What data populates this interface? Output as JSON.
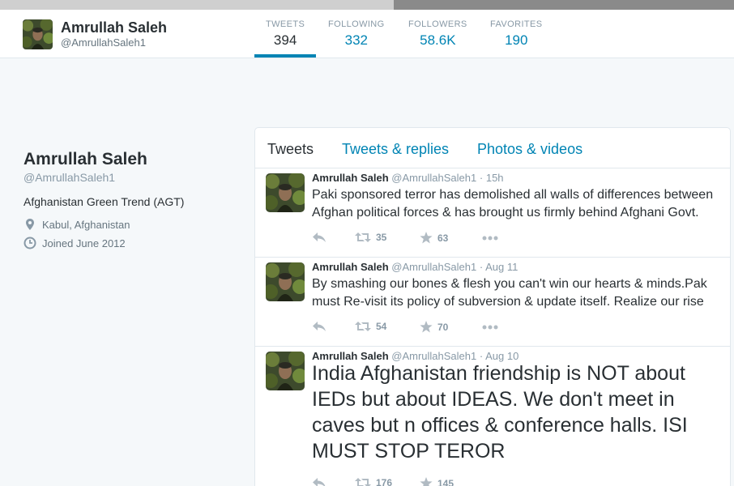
{
  "header": {
    "name": "Amrullah Saleh",
    "handle": "@AmrullahSaleh1",
    "stats": [
      {
        "label": "TWEETS",
        "value": "394"
      },
      {
        "label": "FOLLOWING",
        "value": "332"
      },
      {
        "label": "FOLLOWERS",
        "value": "58.6K"
      },
      {
        "label": "FAVORITES",
        "value": "190"
      }
    ]
  },
  "profile": {
    "name": "Amrullah Saleh",
    "handle": "@AmrullahSaleh1",
    "bio": "Afghanistan Green Trend (AGT)",
    "location": "Kabul, Afghanistan",
    "joined": "Joined June 2012"
  },
  "tabs": [
    "Tweets",
    "Tweets & replies",
    "Photos & videos"
  ],
  "tweets": [
    {
      "name": "Amrullah Saleh",
      "handle": "@AmrullahSaleh1",
      "dot": "·",
      "time": "15h",
      "text": "Paki sponsored terror has demolished all walls of differences between Afghan political forces & has brought us firmly behind Afghani Govt.",
      "retweets": "35",
      "favorites": "63"
    },
    {
      "name": "Amrullah Saleh",
      "handle": "@AmrullahSaleh1",
      "dot": "·",
      "time": "Aug 11",
      "text": "By smashing our bones & flesh you can't win our hearts & minds.Pak must Re-visit its policy of subversion & update itself. Realize our rise",
      "retweets": "54",
      "favorites": "70"
    },
    {
      "name": "Amrullah Saleh",
      "handle": "@AmrullahSaleh1",
      "dot": "·",
      "time": "Aug 10",
      "text": "India Afghanistan friendship is NOT about IEDs but about IDEAS. We don't meet in caves but n offices & conference halls. ISI MUST STOP TEROR",
      "retweets": "176",
      "favorites": "145"
    }
  ],
  "icons": {
    "reply": "reply-icon",
    "retweet": "retweet-icon",
    "favorite": "star-icon",
    "more": "more-icon",
    "location": "location-pin-icon",
    "calendar": "clock-icon"
  },
  "colors": {
    "accent": "#0084b4",
    "muted": "#8899a6",
    "text": "#292f33"
  }
}
